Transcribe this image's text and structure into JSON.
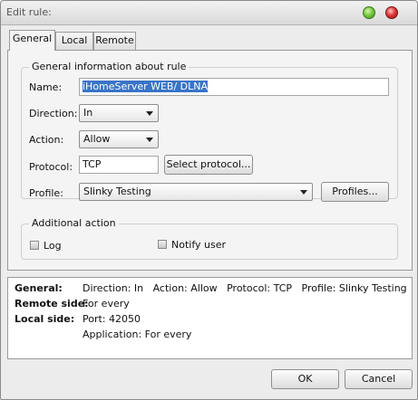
{
  "window": {
    "title": "Edit rule:"
  },
  "tabs": [
    {
      "label": "General"
    },
    {
      "label": "Local"
    },
    {
      "label": "Remote"
    }
  ],
  "general_info": {
    "legend": "General information about rule",
    "name_label": "Name:",
    "name_value": "iHomeServer WEB/ DLNA",
    "direction_label": "Direction:",
    "direction_value": "In",
    "action_label": "Action:",
    "action_value": "Allow",
    "protocol_label": "Protocol:",
    "protocol_value": "TCP",
    "select_protocol_button": "Select protocol...",
    "profile_label": "Profile:",
    "profile_value": "Slinky Testing",
    "profiles_button": "Profiles..."
  },
  "additional_action": {
    "legend": "Additional action",
    "log_label": "Log",
    "log_checked": false,
    "notify_label": "Notify user",
    "notify_checked": false
  },
  "summary": {
    "general_key": "General:",
    "general_value": "Direction: In   Action: Allow   Protocol: TCP   Profile: Slinky Testing",
    "remote_key": "Remote side:",
    "remote_value": "For every",
    "local_key": "Local side:",
    "local_port": "Port: 42050",
    "local_application": "Application: For every"
  },
  "footer": {
    "ok_label": "OK",
    "cancel_label": "Cancel"
  }
}
